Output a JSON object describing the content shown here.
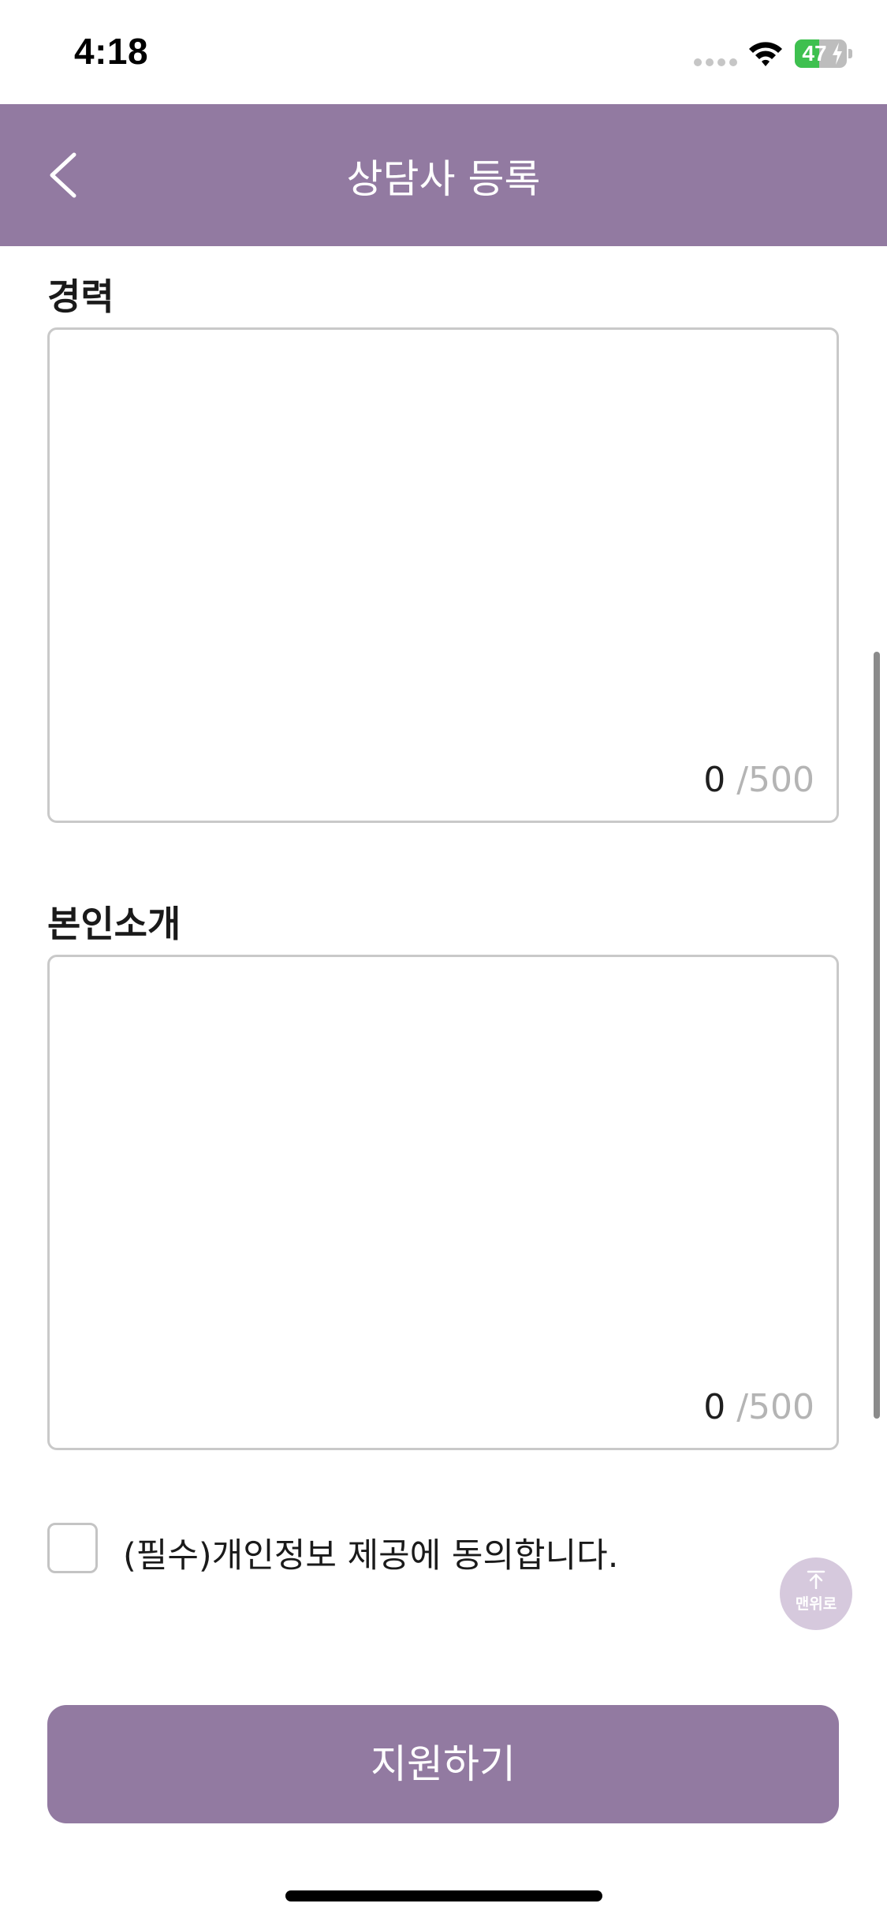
{
  "status_bar": {
    "time": "4:18",
    "battery_percent": "47",
    "battery_level": 0.47,
    "charging": true,
    "icons": [
      "signal-dots-icon",
      "wifi-icon",
      "battery-icon"
    ]
  },
  "header": {
    "title": "상담사 등록",
    "back_icon": "chevron-left-icon",
    "background_color": "#927aa1"
  },
  "form": {
    "career": {
      "label": "경력",
      "value": "",
      "count": "0",
      "max": "/500"
    },
    "introduction": {
      "label": "본인소개",
      "value": "",
      "count": "0",
      "max": "/500"
    },
    "consent": {
      "label": "(필수)개인정보 제공에 동의합니다.",
      "checked": false
    },
    "submit_label": "지원하기"
  },
  "scroll_top": {
    "label": "맨위로",
    "icon": "arrow-up-icon"
  },
  "colors": {
    "accent": "#927aa1",
    "accent_light": "#d6c9dd",
    "border": "#c9c9c9",
    "counter_muted": "#b4b4b4"
  }
}
